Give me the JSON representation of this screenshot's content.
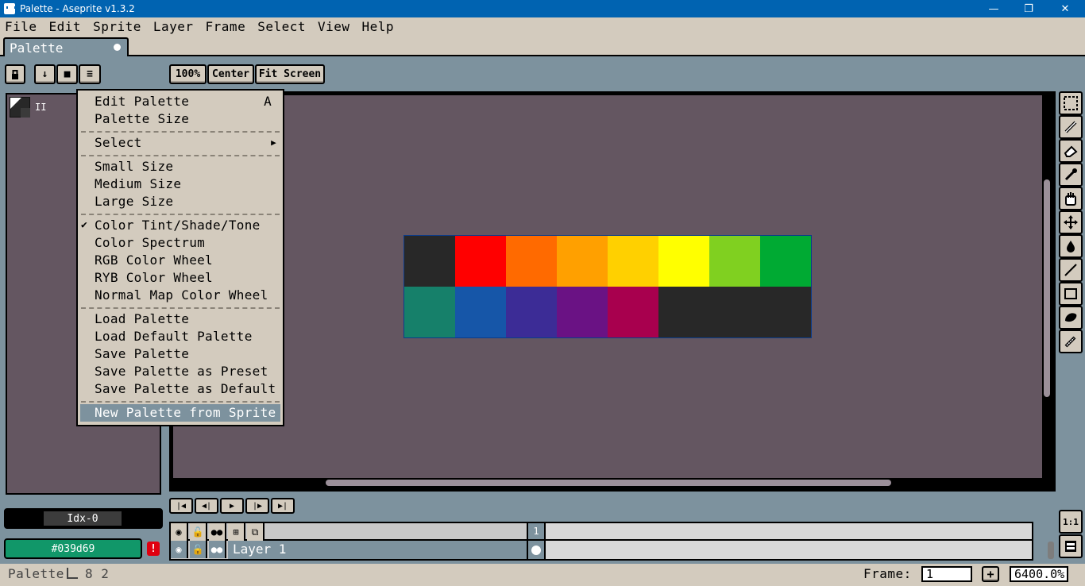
{
  "window": {
    "title": "Palette - Aseprite v1.3.2",
    "minimize": "—",
    "maximize": "❐",
    "close": "✕"
  },
  "menubar": [
    "File",
    "Edit",
    "Sprite",
    "Layer",
    "Frame",
    "Select",
    "View",
    "Help"
  ],
  "tab": {
    "label": "Palette"
  },
  "toolbar": {
    "zoom_100": "100%",
    "center": "Center",
    "fit_screen": "Fit Screen"
  },
  "palette_panel": {
    "marker": "II"
  },
  "context_menu": {
    "items": [
      {
        "label": "Edit Palette",
        "shortcut": "A"
      },
      {
        "label": "Palette Size"
      },
      {
        "label": "Select",
        "submenu": true
      },
      {
        "label": "Small Size"
      },
      {
        "label": "Medium Size"
      },
      {
        "label": "Large Size"
      },
      {
        "label": "Color Tint/Shade/Tone",
        "checked": true
      },
      {
        "label": "Color Spectrum"
      },
      {
        "label": "RGB Color Wheel"
      },
      {
        "label": "RYB Color Wheel"
      },
      {
        "label": "Normal Map Color Wheel"
      },
      {
        "label": "Load Palette"
      },
      {
        "label": "Load Default Palette"
      },
      {
        "label": "Save Palette"
      },
      {
        "label": "Save Palette as Preset"
      },
      {
        "label": "Save Palette as Default"
      },
      {
        "label": "New Palette from Sprite",
        "selected": true
      }
    ]
  },
  "swatches": [
    "#282828",
    "#ff0000",
    "#ff6a00",
    "#ffa000",
    "#ffd000",
    "#ffff00",
    "#80d020",
    "#00aa33",
    "#16806a",
    "#1656a8",
    "#3c2c96",
    "#6a1284",
    "#a8004e",
    "#282828",
    "#282828",
    "#282828"
  ],
  "color_bar": {
    "index_label": "Idx-0",
    "hex": "#039d69",
    "warning": "!"
  },
  "timeline": {
    "frame_number": "1",
    "layer_name": "Layer 1"
  },
  "status": {
    "left_label": "Palette",
    "size": "8 2",
    "frame_label": "Frame:",
    "frame_value": "1",
    "zoom": "6400.0%",
    "add": "+"
  },
  "tools": [
    "marquee-icon",
    "pencil-icon",
    "eraser-icon",
    "eyedropper-icon",
    "hand-icon",
    "move-icon",
    "fill-icon",
    "line-icon",
    "rectangle-icon",
    "contour-icon",
    "blur-icon"
  ],
  "side_buttons": {
    "one_to_one": "1:1"
  }
}
